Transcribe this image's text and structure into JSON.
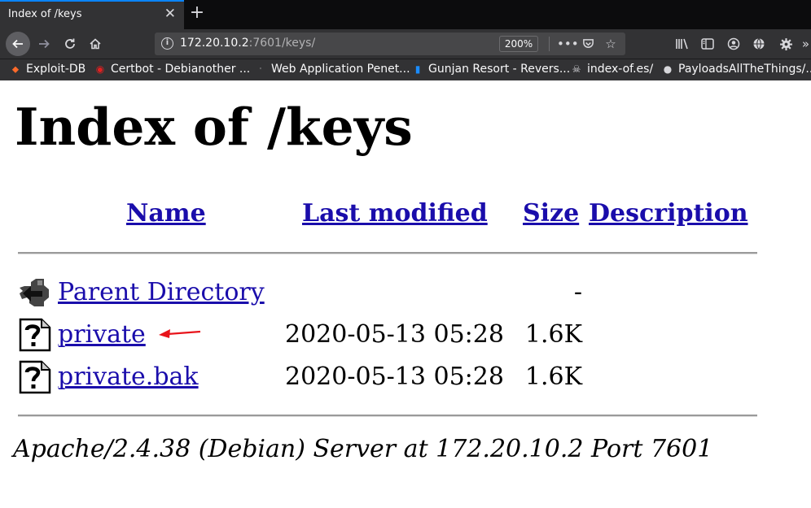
{
  "browser": {
    "tab_title": "Index of /keys",
    "tab_close": "✕",
    "new_tab": "+",
    "url_host": "172.20.10.2",
    "url_rest": ":7601/keys/",
    "zoom": "200%",
    "bookmarks": [
      {
        "label": "Exploit-DB",
        "icon": "exploit-db-icon"
      },
      {
        "label": "Certbot - Debianother ...",
        "icon": "certbot-icon"
      },
      {
        "label": "Web Application Penet...",
        "icon": "dot-icon"
      },
      {
        "label": "Gunjan Resort - Revers...",
        "icon": "bars-icon"
      },
      {
        "label": "index-of.es/",
        "icon": "skull-icon"
      },
      {
        "label": "PayloadsAllTheThings/...",
        "icon": "github-icon"
      }
    ]
  },
  "page": {
    "title": "Index of /keys",
    "columns": {
      "name": "Name",
      "last_modified": "Last modified",
      "size": "Size",
      "description": "Description"
    },
    "rows": [
      {
        "name": "Parent Directory",
        "modified": "",
        "size": "-",
        "icon": "back-folder-icon"
      },
      {
        "name": "private",
        "modified": "2020-05-13 05:28",
        "size": "1.6K",
        "icon": "unknown-file-icon"
      },
      {
        "name": "private.bak",
        "modified": "2020-05-13 05:28",
        "size": "1.6K",
        "icon": "unknown-file-icon"
      }
    ],
    "footer": "Apache/2.4.38 (Debian) Server at 172.20.10.2 Port 7601"
  },
  "colors": {
    "link": "#1a0dab",
    "chrome_dark": "#0c0c0d",
    "toolbar": "#323234",
    "arrow": "#e8141b"
  }
}
